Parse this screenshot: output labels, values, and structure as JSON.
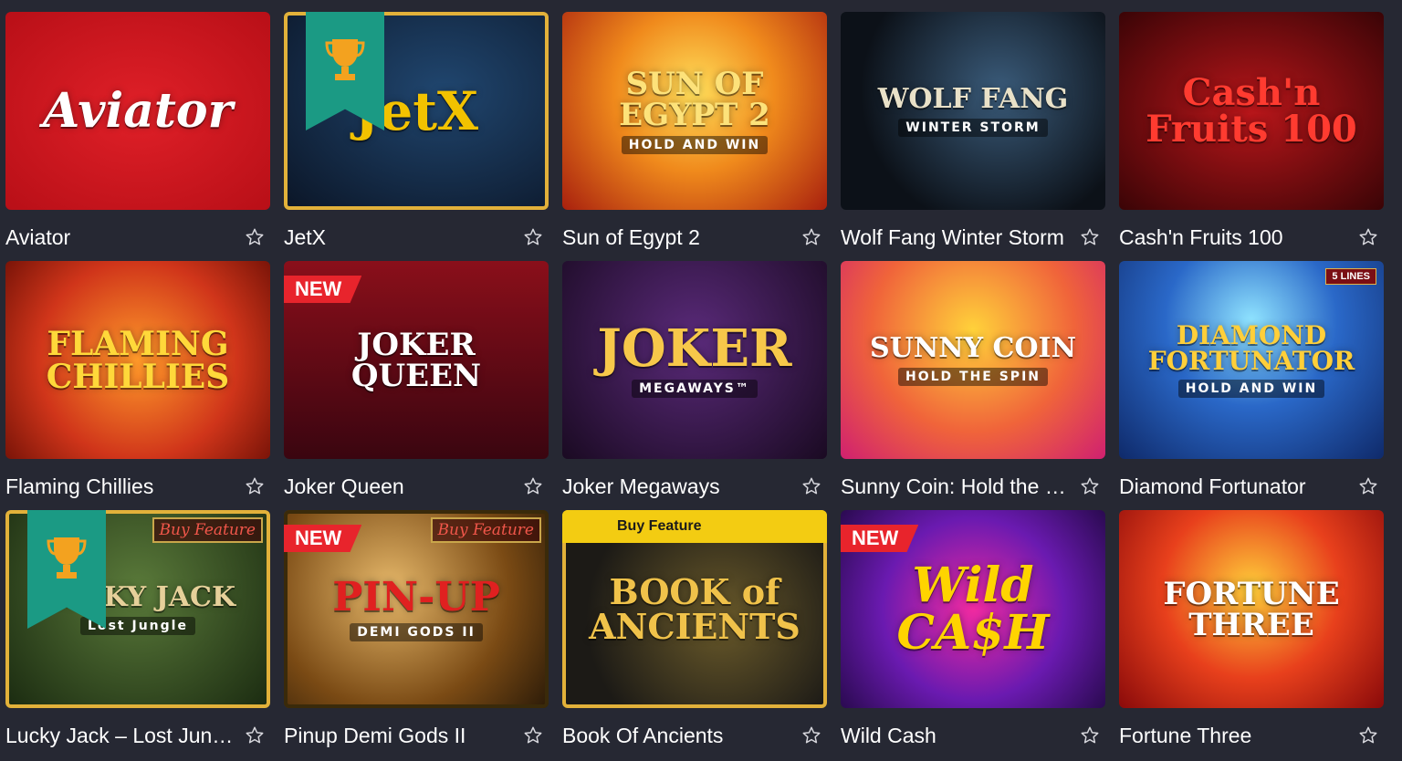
{
  "games": [
    {
      "title": "Aviator",
      "art": "Aviator",
      "bg": "#d0141d",
      "fg": "#ffffff",
      "badge": "",
      "trophy": false,
      "buy": "",
      "sub": ""
    },
    {
      "title": "JetX",
      "art": "JetX",
      "bg": "#12213a",
      "fg": "#f2c200",
      "badge": "",
      "trophy": true,
      "buy": "",
      "sub": ""
    },
    {
      "title": "Sun of Egypt 2",
      "art": "SUN OF EGYPT 2",
      "bg": "#e4631a",
      "fg": "#fde27a",
      "badge": "",
      "trophy": false,
      "buy": "",
      "sub": "HOLD AND WIN"
    },
    {
      "title": "Wolf Fang Winter Storm",
      "art": "WOLF FANG",
      "bg": "#0d1117",
      "fg": "#e9e1c8",
      "badge": "",
      "trophy": false,
      "buy": "",
      "sub": "WINTER STORM"
    },
    {
      "title": "Cash'n Fruits 100",
      "art": "Cash'n Fruits 100",
      "bg": "#8b0f12",
      "fg": "#ff3b30",
      "badge": "",
      "trophy": false,
      "buy": "",
      "sub": ""
    },
    {
      "title": "Flaming Chillies",
      "art": "FLAMING CHILLIES",
      "bg": "#d1461a",
      "fg": "#ffd83a",
      "badge": "",
      "trophy": false,
      "buy": "",
      "sub": ""
    },
    {
      "title": "Joker Queen",
      "art": "JOKER QUEEN",
      "bg": "#7a1018",
      "fg": "#ffffff",
      "badge": "NEW",
      "trophy": false,
      "buy": "",
      "sub": ""
    },
    {
      "title": "Joker Megaways",
      "art": "JOKER",
      "bg": "#2a1238",
      "fg": "#f7c84a",
      "badge": "",
      "trophy": false,
      "buy": "",
      "sub": "MEGAWAYS™"
    },
    {
      "title": "Sunny Coin: Hold the Spin",
      "art": "SUNNY COIN",
      "bg": "#f05a8c",
      "fg": "#ffffff",
      "badge": "",
      "trophy": false,
      "buy": "",
      "sub": "HOLD THE SPIN"
    },
    {
      "title": "Diamond Fortunator",
      "art": "DIAMOND FORTUNATOR",
      "bg": "#1f4ea8",
      "fg": "#ffcf3a",
      "badge": "",
      "trophy": false,
      "buy": "5 LINES",
      "sub": "HOLD AND WIN"
    },
    {
      "title": "Lucky Jack – Lost Jungle",
      "art": "LUCKY JACK",
      "bg": "#2e4a1e",
      "fg": "#e6d09a",
      "badge": "",
      "trophy": true,
      "buy": "Buy Feature",
      "sub": "Lost Jungle"
    },
    {
      "title": "Pinup Demi Gods II",
      "art": "PIN-UP",
      "bg": "#8a5a1a",
      "fg": "#e02020",
      "badge": "NEW",
      "trophy": false,
      "buy": "Buy Feature",
      "sub": "DEMI GODS II"
    },
    {
      "title": "Book Of Ancients",
      "art": "BOOK of ANCIENTS",
      "bg": "#1c1a16",
      "fg": "#f0c24a",
      "badge": "",
      "trophy": false,
      "buy": "Buy Feature",
      "sub": ""
    },
    {
      "title": "Wild Cash",
      "art": "Wild CA$H",
      "bg": "#5a1aa0",
      "fg": "#ffd400",
      "badge": "NEW",
      "trophy": false,
      "buy": "",
      "sub": ""
    },
    {
      "title": "Fortune Three",
      "art": "FORTUNE THREE",
      "bg": "#c8201c",
      "fg": "#ffffff",
      "badge": "",
      "trophy": false,
      "buy": "",
      "sub": ""
    }
  ],
  "colors": {
    "page_bg": "#262833",
    "title_text": "#ffffff",
    "star_outline": "#d8d8de",
    "new_badge": "#e8242c",
    "trophy_ribbon": "#1b9a84"
  },
  "icons": {
    "favorite": "star-outline-icon",
    "trophy": "trophy-icon"
  }
}
